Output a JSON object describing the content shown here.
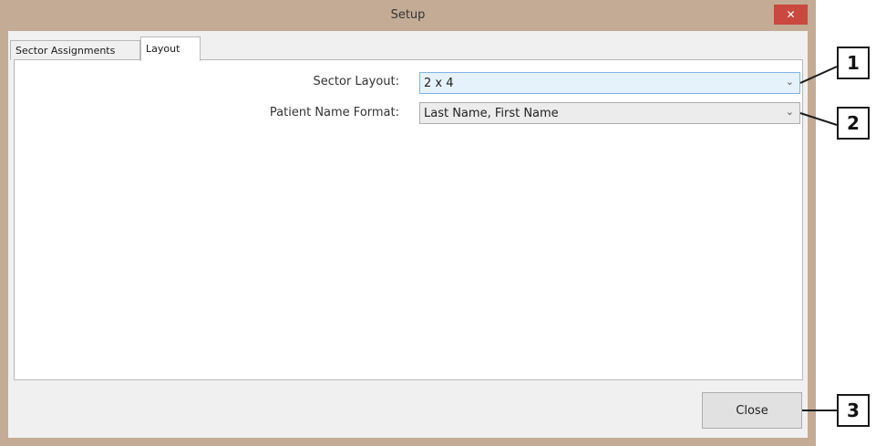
{
  "window": {
    "title": "Setup",
    "close_glyph": "✕"
  },
  "tabs": [
    {
      "label": "Sector Assignments",
      "active": false
    },
    {
      "label": "Layout",
      "active": true
    }
  ],
  "form": {
    "sector_layout": {
      "label": "Sector Layout:",
      "value": "2 x 4"
    },
    "patient_name_format": {
      "label": "Patient Name Format:",
      "value": "Last Name, First Name"
    },
    "chevron_glyph": "⌄"
  },
  "footer": {
    "close_label": "Close"
  },
  "callouts": [
    "1",
    "2",
    "3"
  ],
  "colors": {
    "frame": "#c4ab96",
    "close_button": "#c9483f",
    "focused_combo": "#e5f1fb"
  },
  "icons": {
    "close": "close-icon",
    "dropdown": "chevron-down-icon"
  }
}
